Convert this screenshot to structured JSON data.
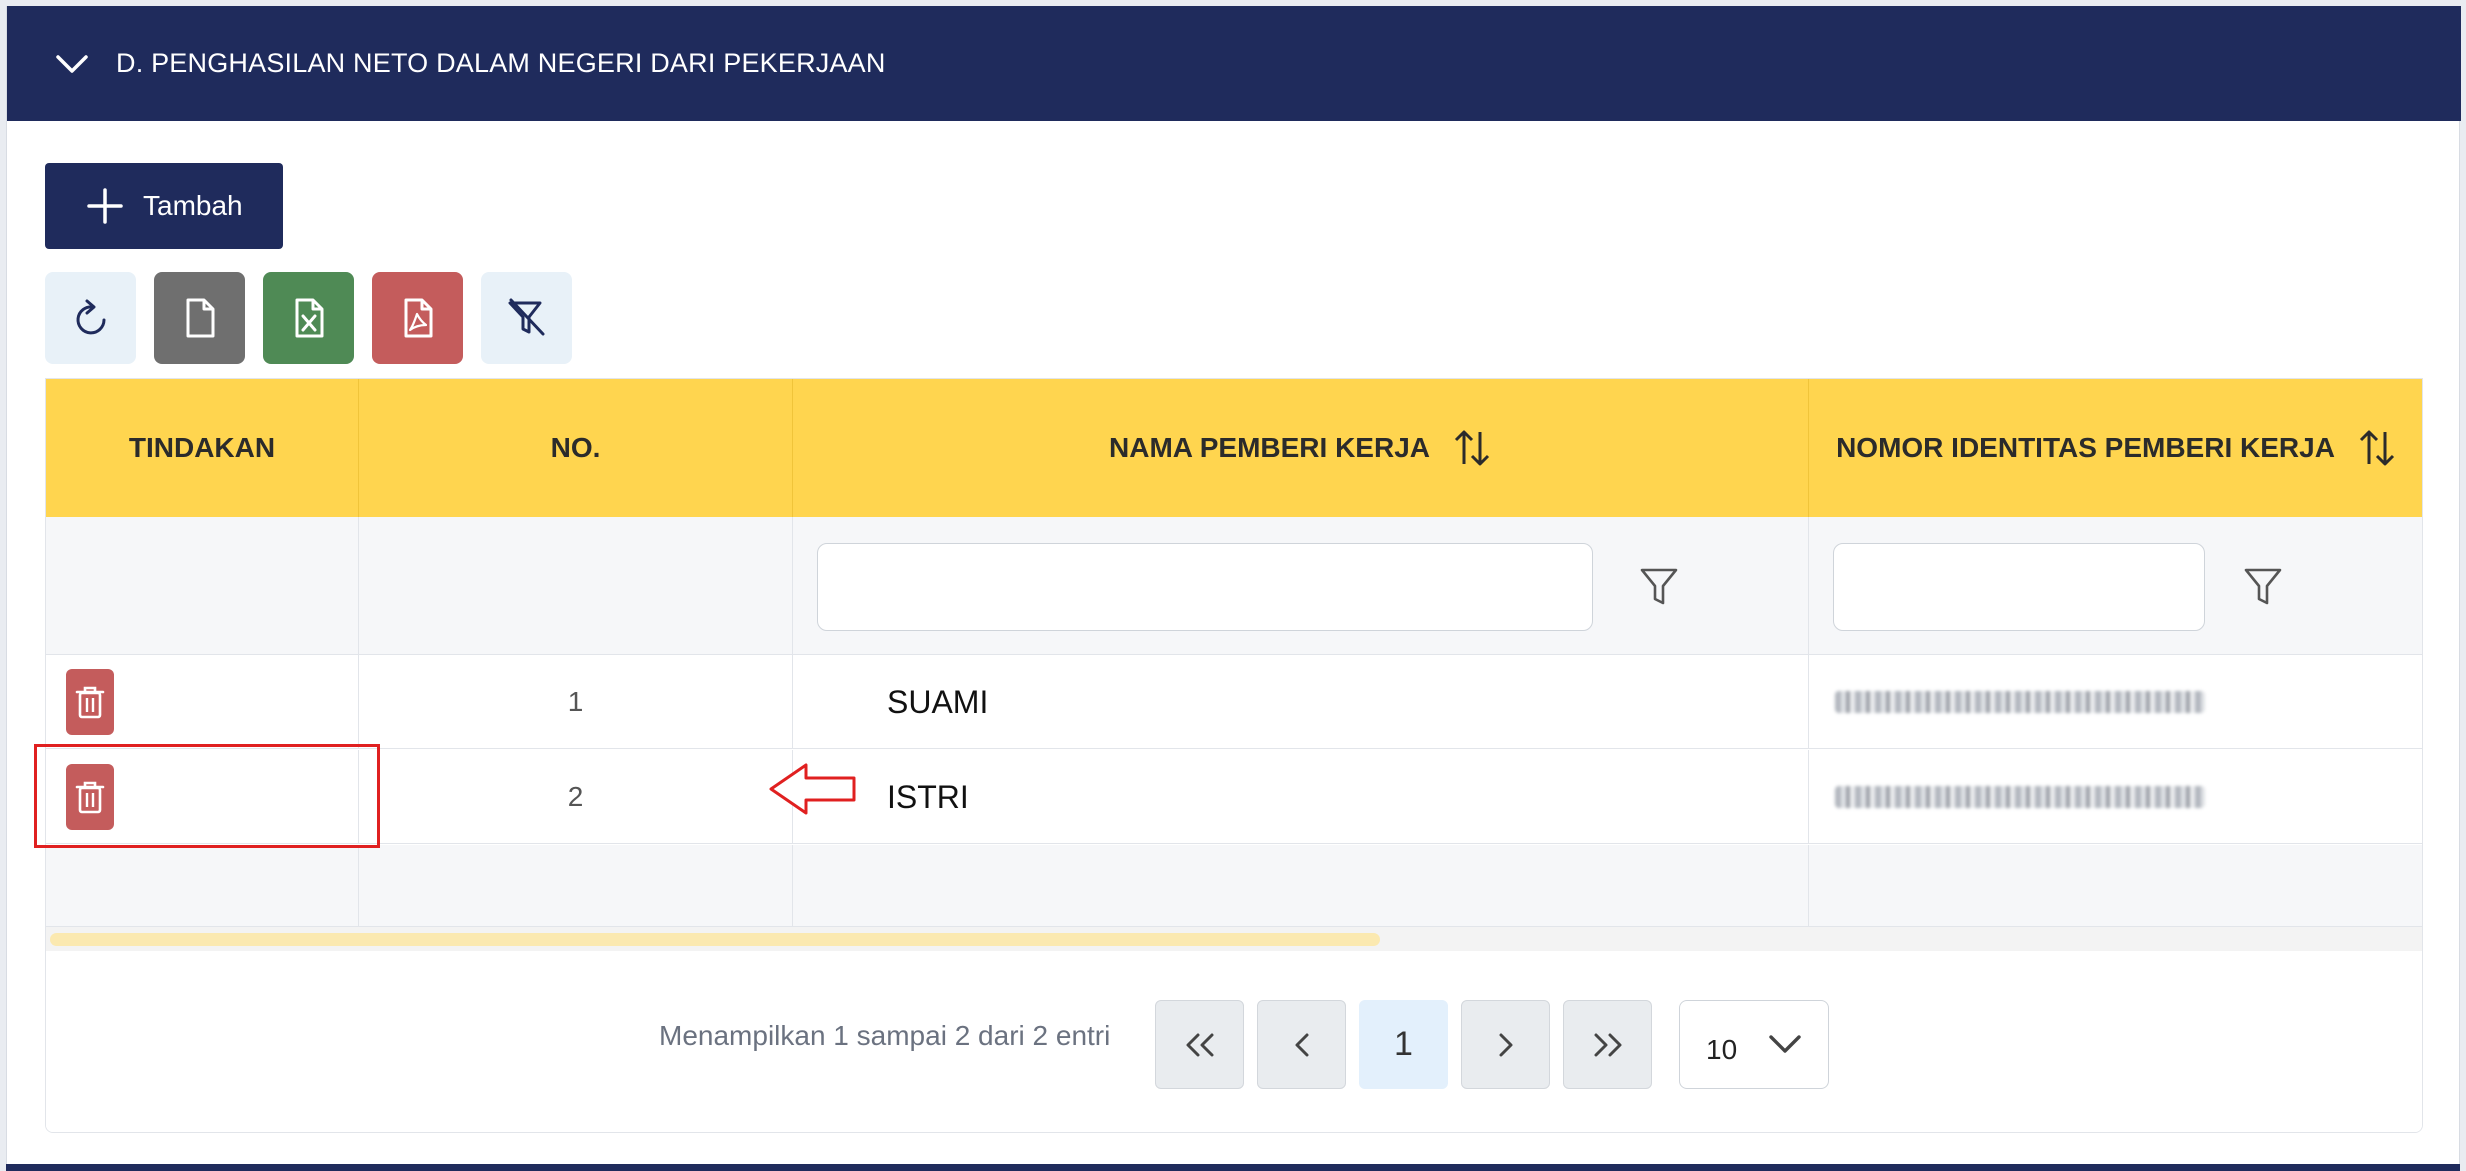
{
  "section": {
    "title": "D. PENGHASILAN NETO DALAM NEGERI DARI PEKERJAAN",
    "toggle_icon": "chevron-down-icon"
  },
  "actions": {
    "add_label": "Tambah",
    "toolbar": [
      {
        "name": "refresh-icon"
      },
      {
        "name": "file-icon"
      },
      {
        "name": "excel-icon"
      },
      {
        "name": "pdf-icon"
      },
      {
        "name": "clear-filter-icon"
      }
    ]
  },
  "table": {
    "columns": [
      {
        "label": "TINDAKAN",
        "sortable": false
      },
      {
        "label": "NO.",
        "sortable": false
      },
      {
        "label": "NAMA PEMBERI KERJA",
        "sortable": true
      },
      {
        "label": "NOMOR IDENTITAS PEMBERI KERJA",
        "sortable": true
      }
    ],
    "filters": {
      "nama_value": "",
      "nik_value": ""
    },
    "rows": [
      {
        "no": "1",
        "nama": "SUAMI"
      },
      {
        "no": "2",
        "nama": "ISTRI"
      }
    ]
  },
  "pagination": {
    "info": "Menampilkan 1 sampai 2 dari 2 entri",
    "first": "«",
    "prev": "‹",
    "current_page": "1",
    "next": "›",
    "last": "»",
    "page_size": "10"
  },
  "colors": {
    "header_navy": "#1f2b5c",
    "table_header_yellow": "#ffd54f",
    "delete_red": "#c45c5c",
    "excel_green": "#4f8a55",
    "annotation_red": "#e02020"
  }
}
